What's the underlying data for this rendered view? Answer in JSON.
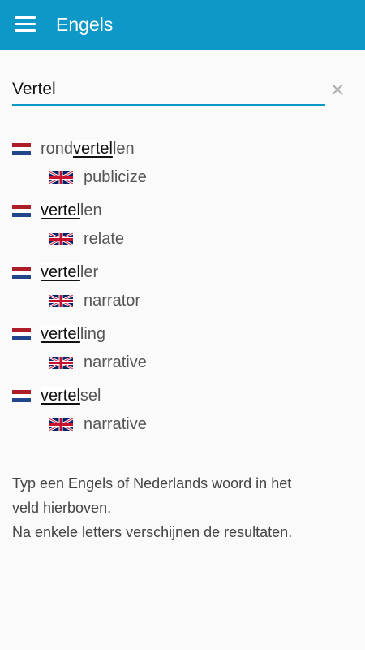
{
  "appbar": {
    "title": "Engels",
    "menu_icon": "menu-icon"
  },
  "search": {
    "value": "Vertel",
    "clear_icon": "close-icon"
  },
  "results": [
    {
      "nl_before": "rond",
      "nl_match": "vertel",
      "nl_after": "len",
      "en": "publicize"
    },
    {
      "nl_before": "",
      "nl_match": "vertel",
      "nl_after": "len",
      "en": "relate"
    },
    {
      "nl_before": "",
      "nl_match": "vertel",
      "nl_after": "ler",
      "en": "narrator"
    },
    {
      "nl_before": "",
      "nl_match": "vertel",
      "nl_after": "ling",
      "en": "narrative"
    },
    {
      "nl_before": "",
      "nl_match": "vertel",
      "nl_after": "sel",
      "en": "narrative"
    }
  ],
  "help": {
    "line1": "Typ een Engels of Nederlands woord in het",
    "line2": "veld hierboven.",
    "line3": "Na enkele letters verschijnen de resultaten."
  },
  "colors": {
    "accent": "#0e98c8",
    "background": "#fafafa"
  }
}
